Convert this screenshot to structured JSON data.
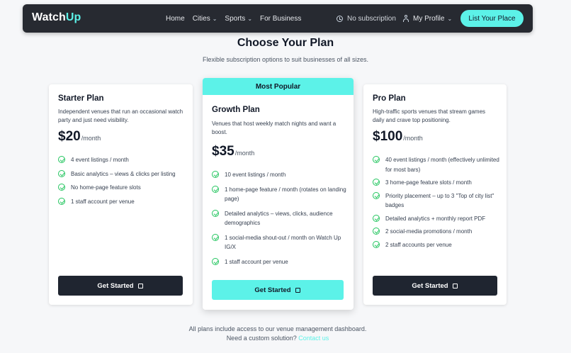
{
  "nav": {
    "logo_main": "Watch",
    "logo_accent": "Up",
    "links": [
      "Home",
      "Cities",
      "Sports",
      "For Business"
    ],
    "subscription": "No subscription",
    "profile": "My Profile",
    "list_button": "List Your Place"
  },
  "header": {
    "title": "Choose Your Plan",
    "subtitle": "Flexible subscription options to suit businesses of all sizes."
  },
  "plans": [
    {
      "name": "Starter Plan",
      "desc": "Independent venues that run an occasional watch party and just need visibility.",
      "price": "$20",
      "period": "/month",
      "features": [
        "4 event listings / month",
        "Basic analytics – views & clicks per listing",
        "No home-page feature slots",
        "1 staff account per venue"
      ],
      "cta": "Get Started"
    },
    {
      "badge": "Most Popular",
      "name": "Growth Plan",
      "desc": "Venues that host weekly match nights and want a boost.",
      "price": "$35",
      "period": "/month",
      "features": [
        "10 event listings / month",
        "1 home-page feature / month (rotates on landing page)",
        "Detailed analytics – views, clicks, audience demographics",
        "1 social-media shout-out / month on Watch Up IG/X",
        "1 staff account per venue"
      ],
      "cta": "Get Started"
    },
    {
      "name": "Pro Plan",
      "desc": "High-traffic sports venues that stream games daily and crave top positioning.",
      "price": "$100",
      "period": "/month",
      "features": [
        "40 event listings / month (effectively unlimited for most bars)",
        "3 home-page feature slots / month",
        "Priority placement – up to 3 \"Top of city list\" badges",
        "Detailed analytics + monthly report PDF",
        "2 social-media promotions / month",
        "2 staff accounts per venue"
      ],
      "cta": "Get Started"
    }
  ],
  "footer": {
    "line1": "All plans include access to our venue management dashboard.",
    "line2": "Need a custom solution?",
    "link": "Contact us"
  },
  "colors": {
    "accent": "#5cf2e8",
    "nav_bg": "#272a31",
    "check": "#22c55e",
    "dark_button": "#1f2530"
  }
}
